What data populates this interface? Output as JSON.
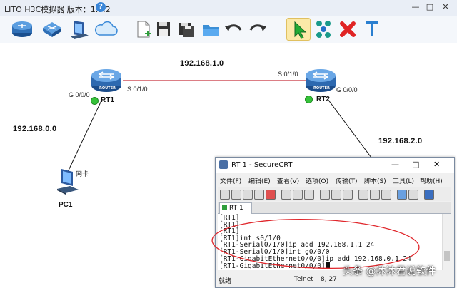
{
  "window": {
    "title": "LITO H3C模拟器 版本：1.5.2",
    "help_icon": "?"
  },
  "toolbar": {
    "items": [
      "router-icon",
      "switch-icon",
      "pc-icon",
      "cloud-icon",
      "new-file-icon",
      "save-icon",
      "save-as-icon",
      "open-folder-icon",
      "undo-icon",
      "redo-icon",
      "select-arrow-icon",
      "connect-icon",
      "delete-icon",
      "text-tool-icon"
    ]
  },
  "topology": {
    "networks": [
      "192.168.1.0",
      "192.168.0.0",
      "192.168.2.0"
    ],
    "rt1": {
      "name": "RT1",
      "iface_g": "G 0/0/0",
      "iface_s": "S 0/1/0",
      "badge": "ROUTER"
    },
    "rt2": {
      "name": "RT2",
      "iface_s": "S 0/1/0",
      "iface_g": "G 0/0/0",
      "badge": "ROUTER"
    },
    "pc1": {
      "name": "PC1",
      "iface": "网卡"
    },
    "link_color": "#c8323c"
  },
  "crt": {
    "title": "RT 1 - SecureCRT",
    "menu": [
      "文件(F)",
      "编辑(E)",
      "查看(V)",
      "选项(O)",
      "传输(T)",
      "脚本(S)",
      "工具(L)",
      "帮助(H)"
    ],
    "tab": "RT 1",
    "terminal_lines": [
      "[RT1]",
      "[RT1]",
      "[RT1]",
      "[RT1]int s0/1/0",
      "[RT1-Serial0/1/0]ip add 192.168.1.1 24",
      "[RT1-Serial0/1/0]int g0/0/0",
      "[RT1-GigabitEthernet0/0/0]ip add 192.168.0.1 24",
      "[RT1-GigabitEthernet0/0/0]"
    ],
    "status": {
      "ready": "就绪",
      "protocol": "Telnet",
      "cursor": "8, 27"
    }
  },
  "watermark": "头条 @沐沐君说软件",
  "colors": {
    "annotation": "#e0262b",
    "status_green": "#36c23a"
  }
}
